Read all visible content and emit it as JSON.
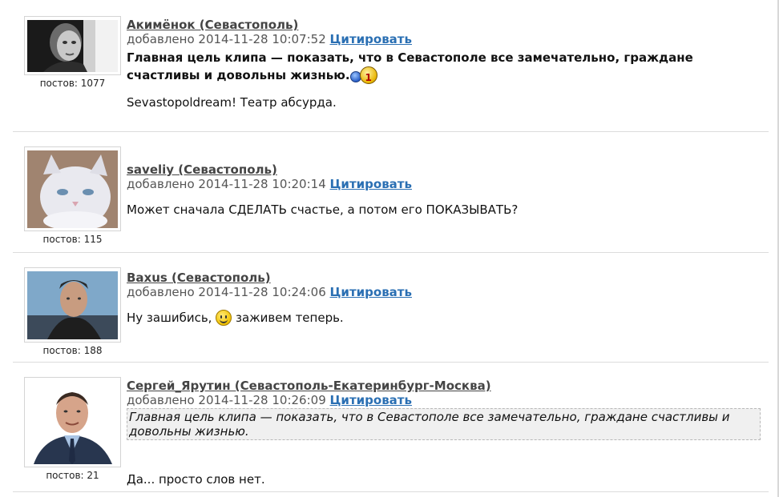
{
  "posts": [
    {
      "author": "Акимёнок (Севастополь)",
      "added_prefix": "добавлено",
      "timestamp": "2014-11-28 10:07:52",
      "quote_label": "Цитировать",
      "post_count_label": "постов: 1077",
      "message_bold": "Главная цель клипа — показать, что в Севастополе все замечательно, граждане счастливы и довольны жизнью.",
      "message": "Sevastopoldream! Театр абсурда.",
      "emoticon": "medal-emoticon"
    },
    {
      "author": "saveliy (Севастополь)",
      "added_prefix": "добавлено",
      "timestamp": "2014-11-28 10:20:14",
      "quote_label": "Цитировать",
      "post_count_label": "постов: 115",
      "message": "Может сначала СДЕЛАТЬ счастье, а потом его ПОКАЗЫВАТЬ?"
    },
    {
      "author": "Baxus (Севастополь)",
      "added_prefix": "добавлено",
      "timestamp": "2014-11-28 10:24:06",
      "quote_label": "Цитировать",
      "post_count_label": "постов: 188",
      "message_before": "Ну зашибись,",
      "message_after": "заживем теперь.",
      "emoticon": "smiley-icon"
    },
    {
      "author": "Сергей_Ярутин (Севастополь-Екатеринбург-Москва)",
      "added_prefix": "добавлено",
      "timestamp": "2014-11-28 10:26:09",
      "quote_label": "Цитировать",
      "post_count_label": "постов: 21",
      "quoted_text": "Главная цель клипа — показать, что в Севастополе все замечательно, граждане счастливы и довольны жизнью.",
      "message": "Да... просто слов нет."
    }
  ]
}
